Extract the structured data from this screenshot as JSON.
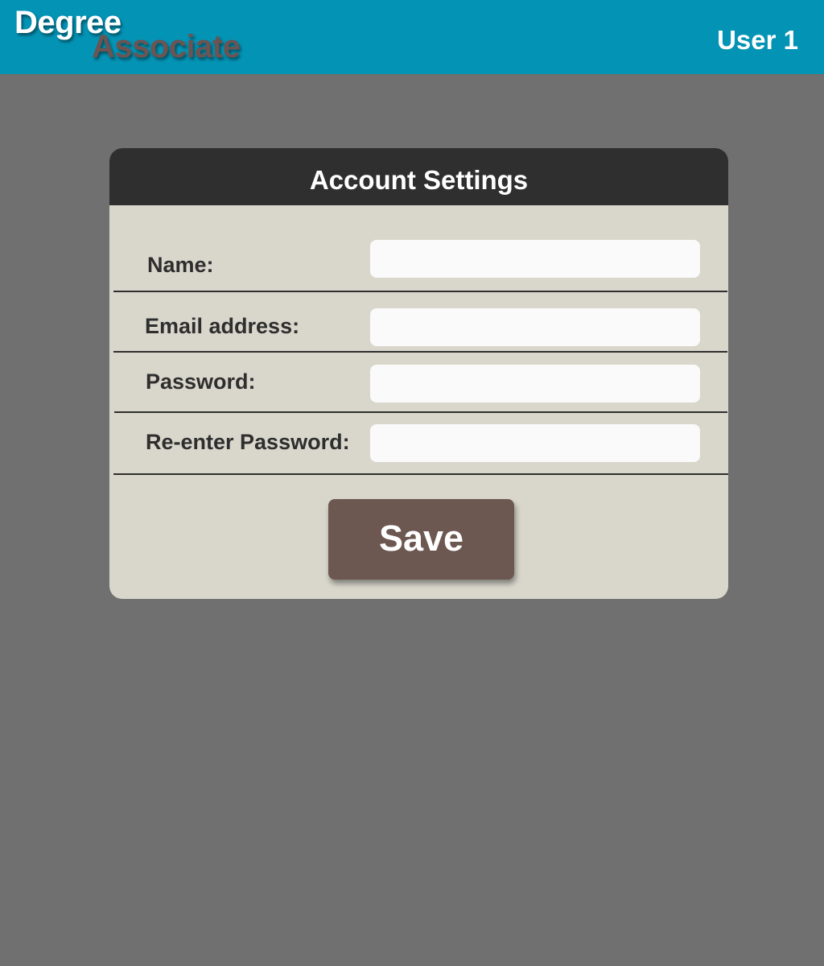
{
  "header": {
    "logo_line1": "Degree",
    "logo_line2": "Associate",
    "user_label": "User 1"
  },
  "form": {
    "title": "Account Settings",
    "fields": [
      {
        "label": "Name:",
        "value": "",
        "placeholder": ""
      },
      {
        "label": "Email address:",
        "value": "",
        "placeholder": ""
      },
      {
        "label": "Password:",
        "value": "",
        "placeholder": ""
      },
      {
        "label": "Re-enter Password:",
        "value": "",
        "placeholder": ""
      }
    ],
    "save_label": "Save"
  },
  "colors": {
    "topbar": "#0393b5",
    "background": "#707070",
    "card": "#d9d7cc",
    "card_header": "#2f2f2f",
    "save_button": "#6d5751",
    "logo_associate": "#6b5452"
  }
}
